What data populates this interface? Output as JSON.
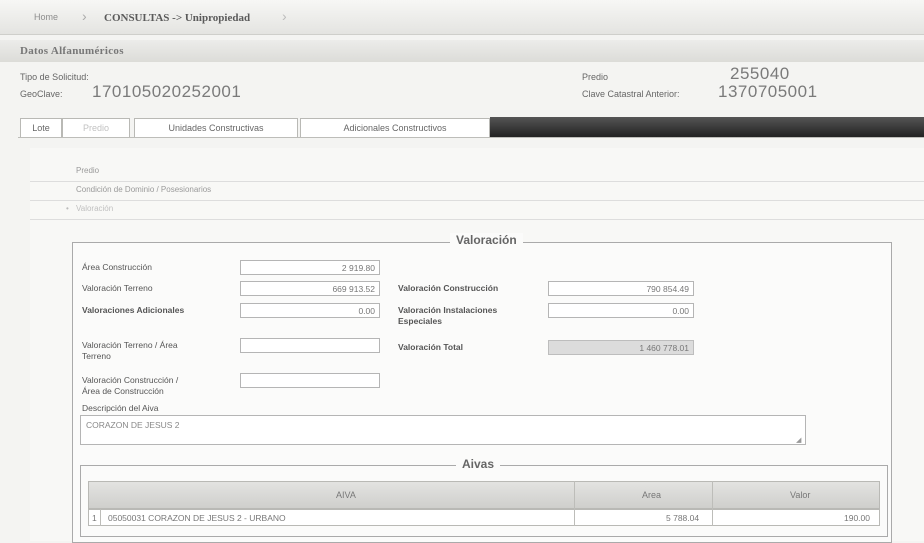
{
  "breadcrumb": {
    "home": "Home",
    "current": "CONSULTAS -> Unipropiedad",
    "separator": "›"
  },
  "section": {
    "title": "Datos Alfanuméricos"
  },
  "header_fields": {
    "tipo_solicitud_label": "Tipo de Solicitud:",
    "geoclave_label": "GeoClave:",
    "geoclave_value": "170105020252001",
    "predio_label": "Predio",
    "predio_value": "255040",
    "clave_anterior_label": "Clave Catastral Anterior:",
    "clave_anterior_value": "1370705001"
  },
  "tabs": [
    "Lote",
    "Predio",
    "Unidades Constructivas",
    "Adicionales Constructivos"
  ],
  "accordion": [
    "Predio",
    "Condición de Dominio / Posesionarios",
    "Valoración"
  ],
  "valoracion": {
    "legend": "Valoración",
    "area_construccion_label": "Área Construcción",
    "area_construccion_value": "2 919.80",
    "valoracion_terreno_label": "Valoración Terreno",
    "valoracion_terreno_value": "669 913.52",
    "valoracion_construccion_label": "Valoración Construcción",
    "valoracion_construccion_value": "790 854.49",
    "valoraciones_adicionales_label": "Valoraciones Adicionales",
    "valoraciones_adicionales_value": "0.00",
    "valoracion_instalaciones_label_1": "Valoración Instalaciones",
    "valoracion_instalaciones_label_2": "Especiales",
    "valoracion_instalaciones_value": "0.00",
    "valoracion_terreno_area_label_1": "Valoración Terreno / Área",
    "valoracion_terreno_area_label_2": "Terreno",
    "valoracion_total_label": "Valoración Total",
    "valoracion_total_value": "1 460 778.01",
    "valoracion_construccion_area_label_1": "Valoración Construcción /",
    "valoracion_construccion_area_label_2": "Área de Construcción",
    "descripcion_label": "Descripción del Aiva",
    "descripcion_value": "CORAZON DE JESUS 2"
  },
  "aivas": {
    "legend": "Aivas",
    "columns": [
      "AIVA",
      "Area",
      "Valor"
    ],
    "rows": [
      {
        "num": "1",
        "aiva": "05050031 CORAZON DE JESUS 2 - URBANO",
        "area": "5 788.04",
        "valor": "190.00"
      }
    ]
  }
}
